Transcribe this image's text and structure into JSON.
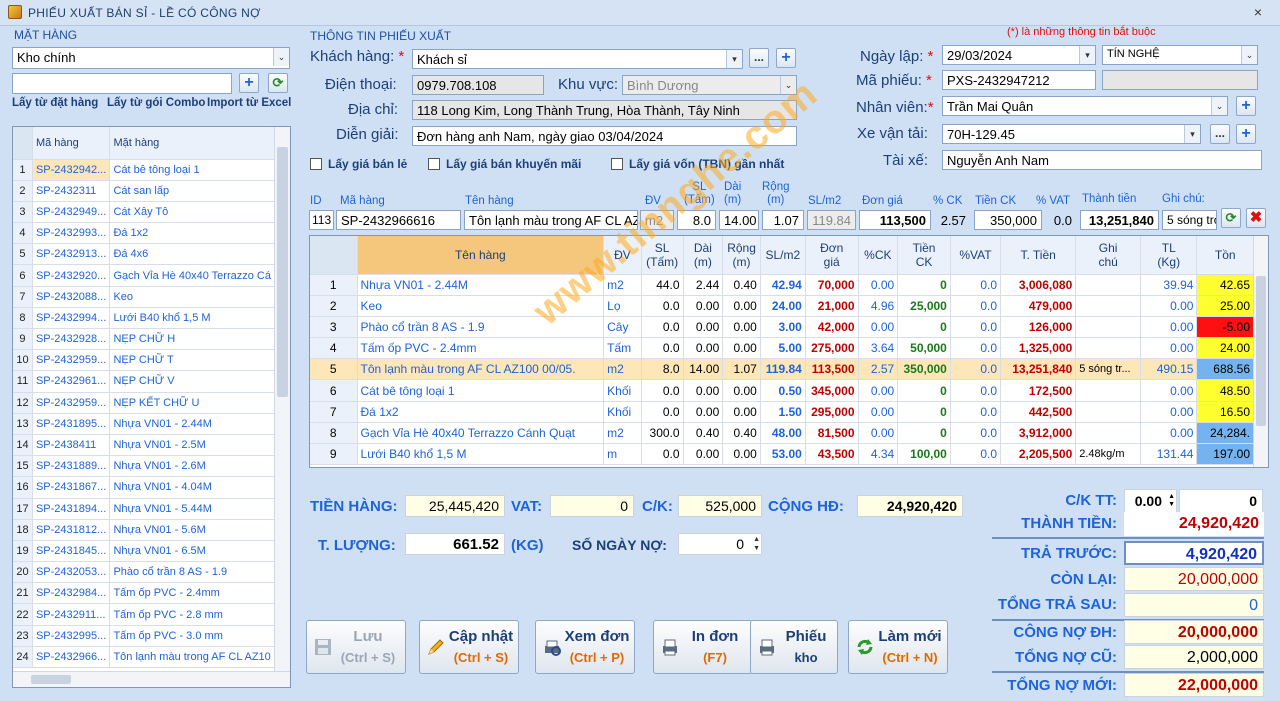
{
  "window": {
    "title": "PHIẾU XUẤT BÁN SỈ - LỀ CÓ CÔNG NỢ",
    "close": "×"
  },
  "left": {
    "section": "MẶT HÀNG",
    "warehouse": "Kho chính",
    "search_value": "",
    "links": [
      "Lấy từ đặt hàng",
      "Lấy từ gói Combo",
      "Import từ Excel"
    ],
    "columns": [
      "Mã hàng",
      "Mặt hàng"
    ],
    "rows": [
      [
        "1",
        "SP-2432942...",
        "Cát bê tông loại 1"
      ],
      [
        "2",
        "SP-2432311",
        "Cát san lấp"
      ],
      [
        "3",
        "SP-2432949...",
        "Cát Xây Tô"
      ],
      [
        "4",
        "SP-2432993...",
        "Đá 1x2"
      ],
      [
        "5",
        "SP-2432913...",
        "Đá 4x6"
      ],
      [
        "6",
        "SP-2432920...",
        "Gạch Vỉa Hè 40x40 Terrazzo Cá"
      ],
      [
        "7",
        "SP-2432088...",
        "Keo"
      ],
      [
        "8",
        "SP-2432994...",
        "Lưới B40 khổ 1,5 M"
      ],
      [
        "9",
        "SP-2432928...",
        "NẸP CHỮ H"
      ],
      [
        "10",
        "SP-2432959...",
        "NẸP CHỮ T"
      ],
      [
        "11",
        "SP-2432961...",
        "NẸP CHỮ V"
      ],
      [
        "12",
        "SP-2432959...",
        "NẸP KẾT CHỮ U"
      ],
      [
        "13",
        "SP-2431895...",
        "Nhựa VN01 - 2.44M"
      ],
      [
        "14",
        "SP-2438411",
        "Nhựa VN01 - 2.5M"
      ],
      [
        "15",
        "SP-2431889...",
        "Nhựa VN01 - 2.6M"
      ],
      [
        "16",
        "SP-2431867...",
        "Nhựa VN01 - 4.04M"
      ],
      [
        "17",
        "SP-2431894...",
        "Nhựa VN01 - 5.44M"
      ],
      [
        "18",
        "SP-2431812...",
        "Nhựa VN01 - 5.6M"
      ],
      [
        "19",
        "SP-2431845...",
        "Nhựa VN01 - 6.5M"
      ],
      [
        "20",
        "SP-2432053...",
        "Phào cổ trần 8 AS - 1.9"
      ],
      [
        "21",
        "SP-2432984...",
        "Tấm ốp PVC - 2.4mm"
      ],
      [
        "22",
        "SP-2432911...",
        "Tấm ốp PVC - 2.8 mm"
      ],
      [
        "23",
        "SP-2432995...",
        "Tấm ốp PVC - 3.0 mm"
      ],
      [
        "24",
        "SP-2432966...",
        "Tôn lạnh màu trong AF CL AZ10"
      ]
    ]
  },
  "info": {
    "section": "THÔNG TIN PHIẾU XUẤT",
    "required_note": "(*) là những thông tin bắt buộc",
    "customer_label": "Khách hàng:",
    "customer": "Khách sỉ",
    "phone_label": "Điện thoại:",
    "phone": "0979.708.108",
    "area_label": "Khu vực:",
    "area": "Bình Dương",
    "address_label": "Địa chỉ:",
    "address": "118 Long Kim, Long Thành Trung, Hòa Thành, Tây Ninh",
    "note_label": "Diễn giải:",
    "note": "Đơn hàng anh Nam, ngày giao 03/04/2024",
    "checks": [
      "Lấy giá bán lẻ",
      "Lấy giá bán khuyến mãi",
      "Lấy giá vốn (TBN) gần nhất"
    ],
    "date_label": "Ngày lập:",
    "date": "29/03/2024",
    "branch": "TÍN NGHỆ",
    "code_label": "Mã phiếu:",
    "code": "PXS-2432947212",
    "code_extra": "",
    "staff_label": "Nhân viên:",
    "staff": "Trần Mai Quân",
    "vehicle_label": "Xe vận tải:",
    "vehicle": "70H-129.45",
    "driver_label": "Tài xế:",
    "driver": "Nguyễn Anh Nam"
  },
  "entry": {
    "headers": [
      "ID",
      "Mã hàng",
      "Tên hàng",
      "ĐV",
      "SL\n(Tấm)",
      "Dài\n(m)",
      "Rộng\n(m)",
      "SL/m2",
      "Đơn giá",
      "% CK",
      "Tiền CK",
      "% VAT",
      "Thành tiền",
      "Ghi chú:"
    ],
    "id": "113",
    "code": "SP-2432966616",
    "name": "Tôn lạnh màu trong AF CL AZ100",
    "unit": "m2",
    "qty": "8.0",
    "length": "14.00",
    "width": "1.07",
    "slm2": "119.84",
    "price": "113,500",
    "ck": "2.57",
    "ck_money": "350,000",
    "vat": "0.0",
    "total": "13,251,840",
    "remark": "5 sóng trò"
  },
  "main": {
    "columns": [
      "Tên hàng",
      "ĐV",
      "SL\n(Tấm)",
      "Dài\n(m)",
      "Rộng\n(m)",
      "SL/m2",
      "Đơn\ngiá",
      "%CK",
      "Tiền\nCK",
      "%VAT",
      "T. Tiền",
      "Ghi\nchú",
      "TL\n(Kg)",
      "Tồn"
    ],
    "rows": [
      [
        "1",
        "Nhựa VN01 - 2.44M",
        "m2",
        "44.0",
        "2.44",
        "0.40",
        "42.94",
        "70,000",
        "0.00",
        "0",
        "0.0",
        "3,006,080",
        "",
        "39.94",
        "42.65"
      ],
      [
        "2",
        "Keo",
        "Lọ",
        "0.0",
        "0.00",
        "0.00",
        "24.00",
        "21,000",
        "4.96",
        "25,000",
        "0.0",
        "479,000",
        "",
        "0.00",
        "25.00"
      ],
      [
        "3",
        "Phào cổ trần 8 AS - 1.9",
        "Cây",
        "0.0",
        "0.00",
        "0.00",
        "3.00",
        "42,000",
        "0.00",
        "0",
        "0.0",
        "126,000",
        "",
        "0.00",
        "-5.00"
      ],
      [
        "4",
        "Tấm ốp PVC - 2.4mm",
        "Tấm",
        "0.0",
        "0.00",
        "0.00",
        "5.00",
        "275,000",
        "3.64",
        "50,000",
        "0.0",
        "1,325,000",
        "",
        "0.00",
        "24.00"
      ],
      [
        "5",
        "Tôn lạnh màu trong AF CL AZ100 00/05.",
        "m2",
        "8.0",
        "14.00",
        "1.07",
        "119.84",
        "113,500",
        "2.57",
        "350,000",
        "0.0",
        "13,251,840",
        "5 sóng tr...",
        "490.15",
        "688.56"
      ],
      [
        "6",
        "Cát bê tông loại 1",
        "Khối",
        "0.0",
        "0.00",
        "0.00",
        "0.50",
        "345,000",
        "0.00",
        "0",
        "0.0",
        "172,500",
        "",
        "0.00",
        "48.50"
      ],
      [
        "7",
        "Đá 1x2",
        "Khối",
        "0.0",
        "0.00",
        "0.00",
        "1.50",
        "295,000",
        "0.00",
        "0",
        "0.0",
        "442,500",
        "",
        "0.00",
        "16.50"
      ],
      [
        "8",
        "Gạch Vỉa Hè 40x40 Terrazzo Cánh Quạt",
        "m2",
        "300.0",
        "0.40",
        "0.40",
        "48.00",
        "81,500",
        "0.00",
        "0",
        "0.0",
        "3,912,000",
        "",
        "0.00",
        "24,284."
      ],
      [
        "9",
        "Lưới B40 khổ 1,5 M",
        "m",
        "0.0",
        "0.00",
        "0.00",
        "53.00",
        "43,500",
        "4.34",
        "100,00",
        "0.0",
        "2,205,500",
        "2.48kg/m",
        "131.44",
        "197.00"
      ]
    ],
    "stock_colors": [
      "#ffff30",
      "#ffff30",
      "#ff1010",
      "#ffff30",
      "#74b3f0",
      "#ffff30",
      "#ffff30",
      "#74b3f0",
      "#74b3f0"
    ]
  },
  "totals": {
    "goods_label": "TIỀN HÀNG:",
    "goods": "25,445,420",
    "vat_label": "VAT:",
    "vat": "0",
    "ck_label": "C/K:",
    "ck": "525,000",
    "sum_label": "CỘNG HĐ:",
    "sum": "24,920,420",
    "weight_label": "T. LƯỢNG:",
    "weight": "661.52",
    "weight_unit": "(KG)",
    "days_label": "SỐ NGÀY NỢ:",
    "days": "0"
  },
  "summary": {
    "cktt_label": "C/K TT:",
    "cktt_pct": "0.00",
    "cktt_val": "0",
    "thanh_tien_label": "THÀNH TIỀN:",
    "thanh_tien": "24,920,420",
    "tra_truoc_label": "TRẢ TRƯỚC:",
    "tra_truoc": "4,920,420",
    "con_lai_label": "CÒN LẠI:",
    "con_lai": "20,000,000",
    "tra_sau_label": "TỔNG TRẢ SAU:",
    "tra_sau": "0",
    "no_dh_label": "CÔNG NỢ ĐH:",
    "no_dh": "20,000,000",
    "no_cu_label": "TỔNG NỢ CŨ:",
    "no_cu": "2,000,000",
    "no_moi_label": "TỔNG NỢ MỚI:",
    "no_moi": "22,000,000"
  },
  "actions": [
    {
      "t1": "Lưu",
      "t2": "(Ctrl + S)"
    },
    {
      "t1": "Cập nhật",
      "t2": "(Ctrl + S)"
    },
    {
      "t1": "Xem đơn",
      "t2": "(Ctrl + P)"
    },
    {
      "t1": "In đơn",
      "t2": "(F7)"
    },
    {
      "t1": "Phiếu",
      "t2": "kho"
    },
    {
      "t1": "Làm mới",
      "t2": "(Ctrl + N)"
    }
  ],
  "watermark": "www.tinnghe.com",
  "colors": {
    "accent": "#1e63d8",
    "header": "#1d3f78",
    "selected": "#fde6b8",
    "money_red": "#c00000",
    "ck_green": "#1a7a1a"
  }
}
